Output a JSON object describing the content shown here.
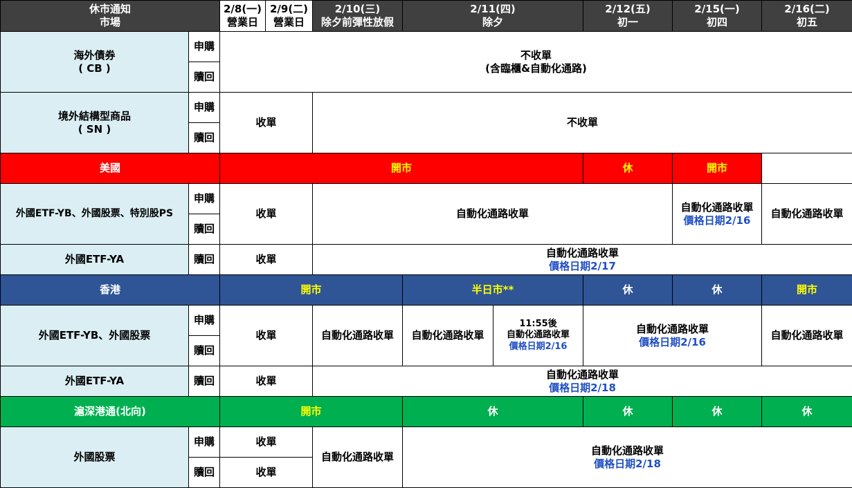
{
  "header": {
    "corner_line1": "休市通知",
    "corner_line2": "市場",
    "cols": [
      {
        "date": "2/8(一)",
        "label": "營業日"
      },
      {
        "date": "2/9(二)",
        "label": "營業日"
      },
      {
        "date": "2/10(三)",
        "label": "除夕前彈性放假"
      },
      {
        "date": "2/11(四)",
        "label": "除夕"
      },
      {
        "date": "2/12(五)",
        "label": "初一"
      },
      {
        "date": "2/15(一)",
        "label": "初四"
      },
      {
        "date": "2/16(二)",
        "label": "初五"
      }
    ]
  },
  "labels": {
    "subscribe": "申購",
    "redeem": "贖回",
    "collect": "收單",
    "no_collect": "不收單",
    "auto_collect": "自動化通路收單",
    "open": "開市",
    "closed": "休",
    "half_day": "半日市**"
  },
  "cb": {
    "name": "海外債券",
    "code": "( CB )",
    "line1": "不收單",
    "line2": "(含臨櫃&自動化通路)"
  },
  "sn": {
    "name": "境外結構型商品",
    "code": "( SN )"
  },
  "us": {
    "name": "美國",
    "etf_yb_name": "外國ETF-YB、外國股票、特別股PS",
    "price_date_216": "價格日期2/16",
    "etf_ya_name": "外國ETF-YA",
    "price_date_217": "價格日期2/17"
  },
  "hk": {
    "name": "香港",
    "etf_yb_name": "外國ETF-YB、外國股票",
    "after_time": "11:55後",
    "price_date_216": "價格日期2/16",
    "etf_ya_name": "外國ETF-YA",
    "price_date_218": "價格日期2/18"
  },
  "sh": {
    "name": "滬深港通(北向)",
    "stock_name": "外國股票",
    "price_date_218": "價格日期2/18"
  },
  "colors": {
    "header_bg": "#404040",
    "market_bg": "#daeef3",
    "us_bar": "#ff0000",
    "hk_bar": "#2f5597",
    "sh_bar": "#00b050",
    "open_text": "#ffff00",
    "price_date": "#1f4fc1"
  }
}
